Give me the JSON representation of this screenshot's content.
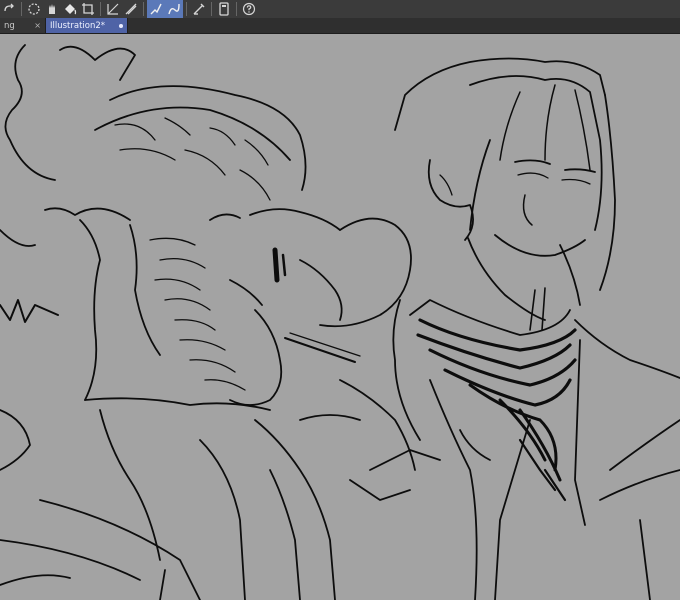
{
  "toolbar": {
    "buttons": [
      {
        "name": "redo",
        "icon": "redo-icon",
        "active": false
      },
      {
        "name": "select-rectangle",
        "icon": "dashed-circle-icon",
        "active": false
      },
      {
        "name": "move",
        "icon": "hand-icon",
        "active": false
      },
      {
        "name": "fill",
        "icon": "bucket-icon",
        "active": false
      },
      {
        "name": "transform",
        "icon": "crop-icon",
        "active": false
      },
      {
        "name": "ruler",
        "icon": "ruler-icon",
        "active": false
      },
      {
        "name": "show-vector",
        "icon": "vector-lines-icon",
        "active": true
      },
      {
        "name": "vector-curve",
        "icon": "vector-curve-icon",
        "active": true
      },
      {
        "name": "snap-pen",
        "icon": "pen-icon",
        "active": false
      },
      {
        "name": "device",
        "icon": "tablet-icon",
        "active": false
      },
      {
        "name": "help",
        "icon": "help-icon",
        "active": false
      }
    ],
    "accent_color": "#5b79b9"
  },
  "tabs": [
    {
      "label": "ng",
      "active": false,
      "close_label": "×"
    },
    {
      "label": "Illustration2*",
      "active": true
    }
  ],
  "canvas": {
    "background_color": "#a3a3a3",
    "stroke_color": "#0d0d0d"
  }
}
